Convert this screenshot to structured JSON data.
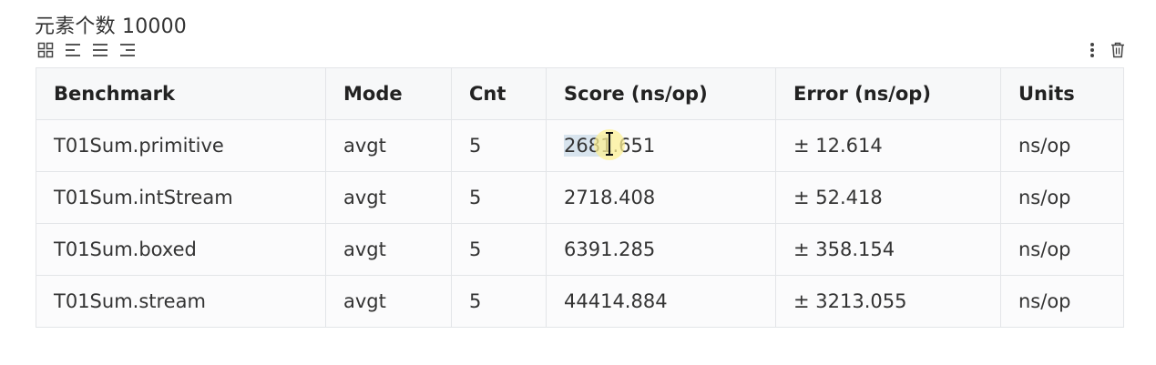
{
  "heading": "元素个数 10000",
  "toolbar_left": [
    {
      "icon": "grid-icon"
    },
    {
      "icon": "align-left-icon"
    },
    {
      "icon": "align-center-icon"
    },
    {
      "icon": "align-right-icon"
    }
  ],
  "toolbar_right": [
    {
      "icon": "more-vertical-icon"
    },
    {
      "icon": "trash-icon"
    }
  ],
  "table": {
    "headers": [
      "Benchmark",
      "Mode",
      "Cnt",
      "Score (ns/op)",
      "Error (ns/op)",
      "Units"
    ],
    "rows": [
      [
        "T01Sum.primitive",
        "avgt",
        "5",
        "2681.651",
        "± 12.614",
        "ns/op"
      ],
      [
        "T01Sum.intStream",
        "avgt",
        "5",
        "2718.408",
        "± 52.418",
        "ns/op"
      ],
      [
        "T01Sum.boxed",
        "avgt",
        "5",
        "6391.285",
        "± 358.154",
        "ns/op"
      ],
      [
        "T01Sum.stream",
        "avgt",
        "5",
        "44414.884",
        "± 3213.055",
        "ns/op"
      ]
    ]
  },
  "selection": {
    "selected_text": "2681",
    "rest_text": ".651"
  },
  "colors": {
    "border": "#e3e5e8",
    "header_bg": "#f7f8f9",
    "cell_bg": "#fbfbfc",
    "selection": "#d8e4ee",
    "cursor_halo": "#fcf096"
  }
}
